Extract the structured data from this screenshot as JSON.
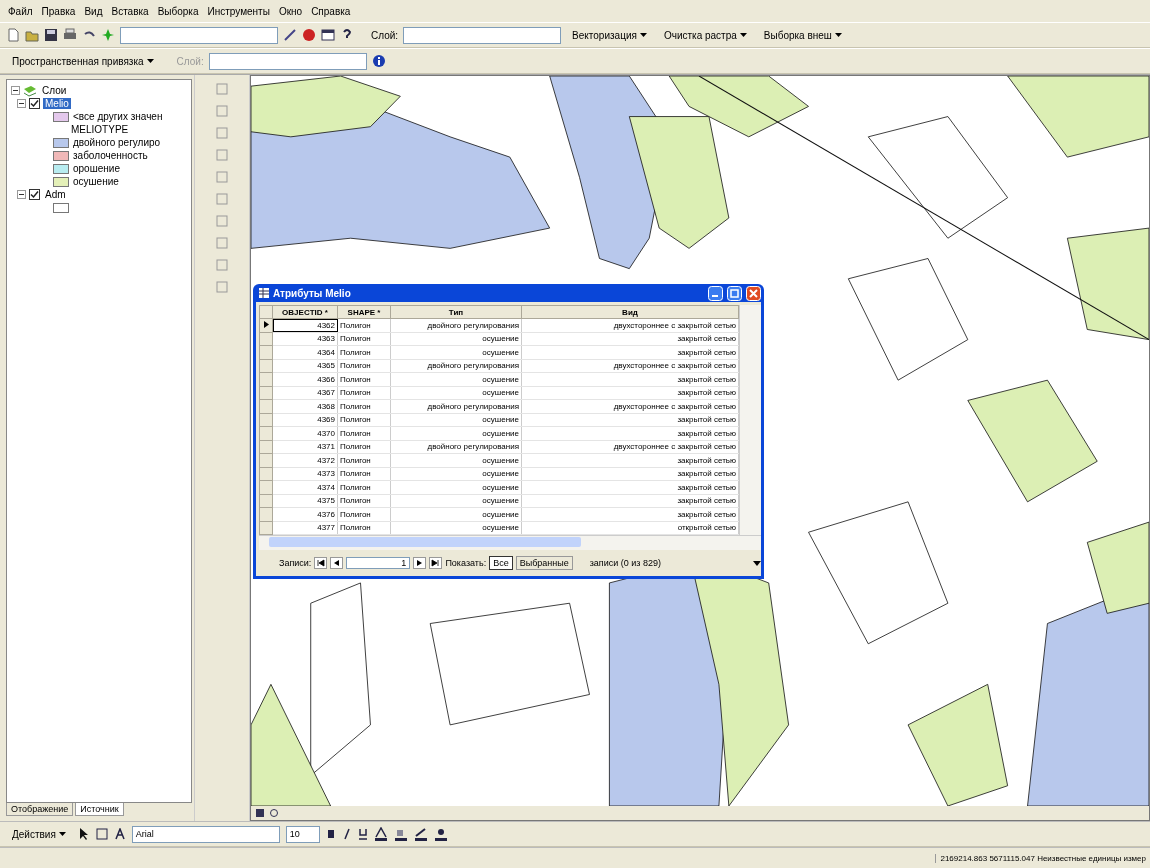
{
  "menu": [
    "Файл",
    "Правка",
    "Вид",
    "Вставка",
    "Выборка",
    "Инструменты",
    "Окно",
    "Справка"
  ],
  "toolbar": {
    "dropdowns": [
      "Векторизация",
      "Очистка растра",
      "Выборка внеш"
    ],
    "layer_label": "Слой:"
  },
  "toolbar2": {
    "dropdown": "Пространственная привязка",
    "layer_label": "Слой:"
  },
  "toc": {
    "root": {
      "label": "Слои",
      "expanded": true,
      "children": [
        {
          "label": "Melio",
          "checked": true,
          "selected": true,
          "expanded": true,
          "legend": [
            {
              "kind": "swatch",
              "label": "<все других значен",
              "color": "#e4c8ec"
            },
            {
              "kind": "heading",
              "label": "MELIOTYPE"
            },
            {
              "kind": "swatch",
              "label": "двойного регулиро",
              "color": "#b8c8ec"
            },
            {
              "kind": "swatch",
              "label": "заболоченность",
              "color": "#f0b8b8"
            },
            {
              "kind": "swatch",
              "label": "орошение",
              "color": "#b8ecf0"
            },
            {
              "kind": "swatch",
              "label": "осушение",
              "color": "#e4f0b8"
            }
          ]
        },
        {
          "label": "Adm",
          "checked": true,
          "selected": false,
          "expanded": true,
          "legend": [
            {
              "kind": "swatch",
              "color": "#ffffff"
            }
          ]
        }
      ]
    }
  },
  "toc_tabs": [
    {
      "label": "Отображение",
      "selected": false
    },
    {
      "label": "Источник",
      "selected": true
    }
  ],
  "table": {
    "title": "Атрибуты Melio",
    "columns": [
      "OBJECTID *",
      "SHAPE *",
      "Тип",
      "Вид"
    ],
    "rows": [
      {
        "current": true,
        "cells": [
          "4362",
          "Полигон",
          "двойного регулирования",
          "двухстороннее с закрытой сетью"
        ]
      },
      {
        "current": false,
        "cells": [
          "4363",
          "Полигон",
          "осушение",
          "закрытой сетью"
        ]
      },
      {
        "current": false,
        "cells": [
          "4364",
          "Полигон",
          "осушение",
          "закрытой сетью"
        ]
      },
      {
        "current": false,
        "cells": [
          "4365",
          "Полигон",
          "двойного регулирования",
          "двухстороннее с закрытой сетью"
        ]
      },
      {
        "current": false,
        "cells": [
          "4366",
          "Полигон",
          "осушение",
          "закрытой сетью"
        ]
      },
      {
        "current": false,
        "cells": [
          "4367",
          "Полигон",
          "осушение",
          "закрытой сетью"
        ]
      },
      {
        "current": false,
        "cells": [
          "4368",
          "Полигон",
          "двойного регулирования",
          "двухстороннее с закрытой сетью"
        ]
      },
      {
        "current": false,
        "cells": [
          "4369",
          "Полигон",
          "осушение",
          "закрытой сетью"
        ]
      },
      {
        "current": false,
        "cells": [
          "4370",
          "Полигон",
          "осушение",
          "закрытой сетью"
        ]
      },
      {
        "current": false,
        "cells": [
          "4371",
          "Полигон",
          "двойного регулирования",
          "двухстороннее с закрытой сетью"
        ]
      },
      {
        "current": false,
        "cells": [
          "4372",
          "Полигон",
          "осушение",
          "закрытой сетью"
        ]
      },
      {
        "current": false,
        "cells": [
          "4373",
          "Полигон",
          "осушение",
          "закрытой сетью"
        ]
      },
      {
        "current": false,
        "cells": [
          "4374",
          "Полигон",
          "осушение",
          "закрытой сетью"
        ]
      },
      {
        "current": false,
        "cells": [
          "4375",
          "Полигон",
          "осушение",
          "закрытой сетью"
        ]
      },
      {
        "current": false,
        "cells": [
          "4376",
          "Полигон",
          "осушение",
          "закрытой сетью"
        ]
      },
      {
        "current": false,
        "cells": [
          "4377",
          "Полигон",
          "осушение",
          "открытой сетью"
        ]
      }
    ],
    "footer": {
      "records_label": "Записи:",
      "record": "1",
      "show_label": "Показать:",
      "show_options": [
        {
          "label": "Все",
          "selected": true
        },
        {
          "label": "Выбранные",
          "selected": false
        }
      ],
      "summary": "записи (0 из 829)"
    }
  },
  "draw_toolbar": {
    "actions": "Действия",
    "font": "Arial",
    "size": "10"
  },
  "status_bar": {
    "coordinates": "2169214.863  5671115.047 Неизвестные единицы измер"
  }
}
